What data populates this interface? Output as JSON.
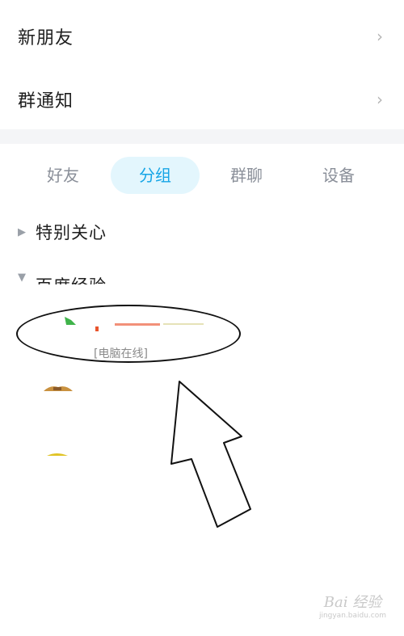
{
  "entries": [
    {
      "label": "新朋友"
    },
    {
      "label": "群通知"
    }
  ],
  "tabs": [
    {
      "label": "好友",
      "active": false
    },
    {
      "label": "分组",
      "active": true
    },
    {
      "label": "群聊",
      "active": false
    },
    {
      "label": "设备",
      "active": false
    }
  ],
  "groups": [
    {
      "name": "特别关心",
      "expanded": false
    },
    {
      "name": "百度经验",
      "expanded": true
    }
  ],
  "contact": {
    "status": "[电脑在线]"
  },
  "colors": {
    "accent": "#16a5e6",
    "tab_active_bg": "#e3f6fd",
    "band": "#f4f5f7"
  },
  "icons": {
    "chevron": "chevron-right-icon",
    "collapsed": "triangle-right-icon",
    "expanded": "triangle-down-icon"
  },
  "watermark": {
    "logo": "Bai 经验",
    "url": "jingyan.baidu.com"
  }
}
